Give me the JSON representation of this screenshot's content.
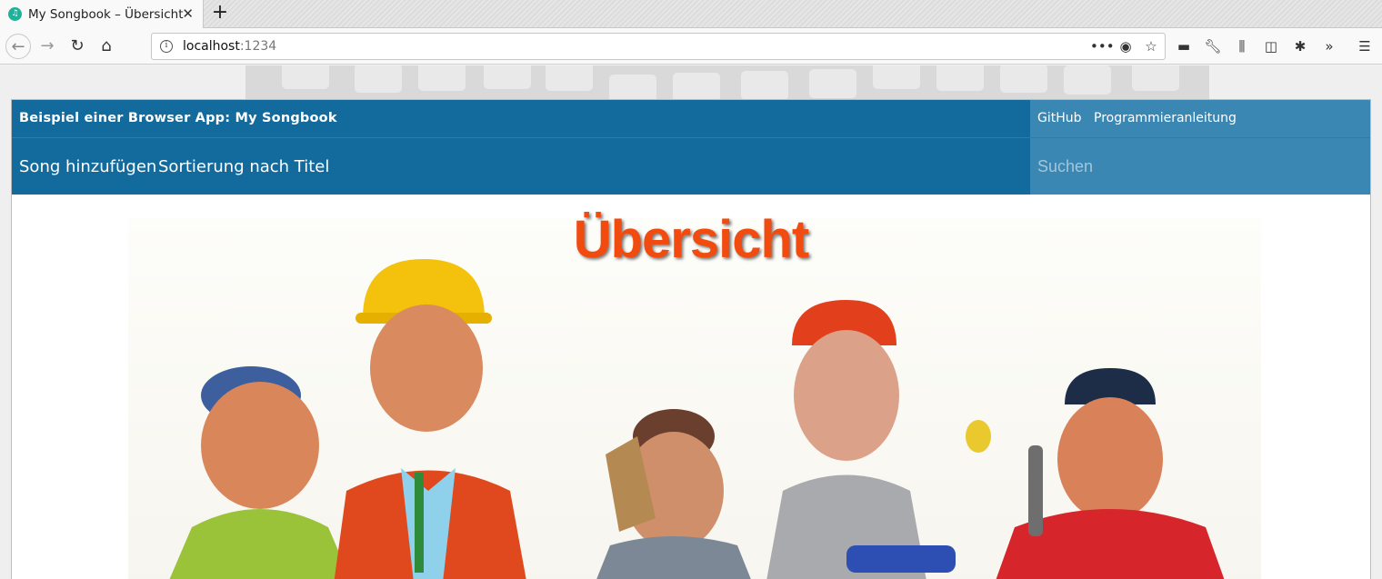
{
  "browser": {
    "tab_title": "My Songbook – Übersicht",
    "tab_favicon": "songbook-favicon",
    "url_host": "localhost",
    "url_port": ":1234"
  },
  "header": {
    "brand": "Beispiel einer Browser App: My Songbook",
    "links": [
      "GitHub",
      "Programmieranleitung"
    ]
  },
  "menu": {
    "items": [
      "Song hinzufügen",
      "Sortierung nach Titel"
    ],
    "search_placeholder": "Suchen"
  },
  "main": {
    "title": "Übersicht"
  },
  "colors": {
    "nav_bg": "#136a9d",
    "nav_accent_bg": "#3a87b3",
    "title_color": "#f24b10"
  }
}
